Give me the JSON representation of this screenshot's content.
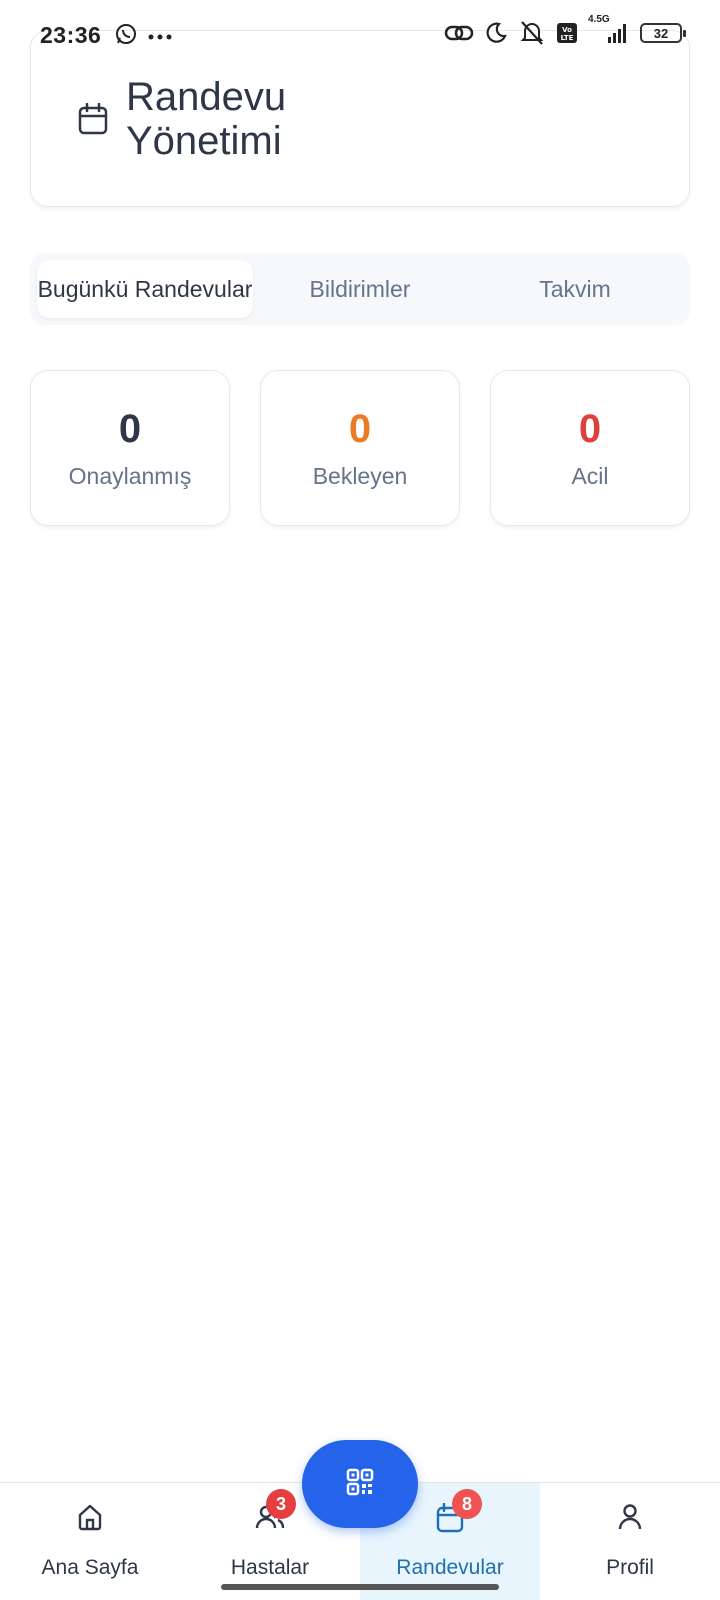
{
  "status_bar": {
    "time": "23:36",
    "network": "4.5G",
    "volte": "Vo LTE",
    "battery": "32"
  },
  "header": {
    "title": "Randevu Yönetimi",
    "icon": "calendar-icon"
  },
  "tabs": [
    {
      "label": "Bugünkü Randevular",
      "active": true
    },
    {
      "label": "Bildirimler",
      "active": false
    },
    {
      "label": "Takvim",
      "active": false
    }
  ],
  "stats": [
    {
      "value": "0",
      "label": "Onaylanmış",
      "color": "#2d3748"
    },
    {
      "value": "0",
      "label": "Bekleyen",
      "color": "#ed7a24"
    },
    {
      "value": "0",
      "label": "Acil",
      "color": "#e0403c"
    }
  ],
  "bottom_nav": [
    {
      "label": "Ana Sayfa",
      "icon": "home-icon",
      "badge": ""
    },
    {
      "label": "Hastalar",
      "icon": "users-icon",
      "badge": "3"
    },
    {
      "label": "Randevular",
      "icon": "calendar-icon",
      "badge": "8",
      "active": true
    },
    {
      "label": "Profil",
      "icon": "user-icon",
      "badge": ""
    }
  ],
  "fab": {
    "icon": "qr-code-icon"
  },
  "colors": {
    "accent": "#2563eb",
    "active_tab_bg": "#e8f5fd",
    "badge": "#e53e3e"
  }
}
